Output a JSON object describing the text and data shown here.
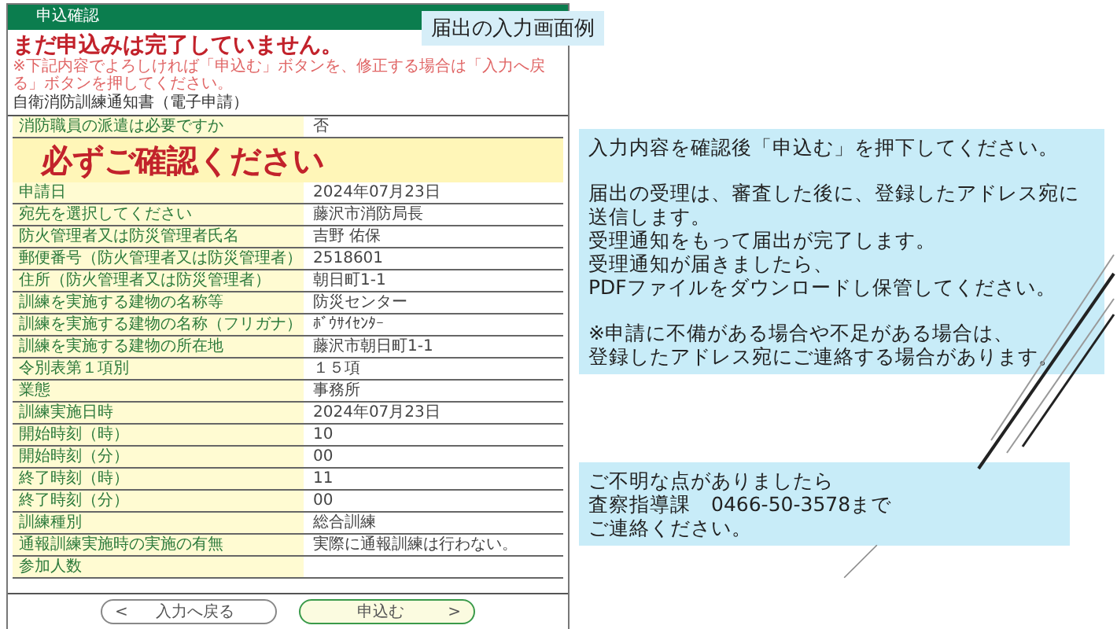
{
  "slide_label": "届出の入力画面例",
  "form": {
    "header": "申込確認",
    "title": "まだ申込みは完了していません。",
    "note": "※下記内容でよろしければ「申込む」ボタンを、修正する場合は「入力へ戻る」ボタンを押してください。",
    "doc_title": "自衛消防訓練通知書（電子申請）",
    "first_row": {
      "label": "消防職員の派遣は必要ですか",
      "value": "否"
    },
    "banner": "必ずご確認ください",
    "rows": [
      {
        "label": "申請日",
        "value": "2024年07月23日"
      },
      {
        "label": "宛先を選択してください",
        "value": "藤沢市消防局長"
      },
      {
        "label": "防火管理者又は防災管理者氏名",
        "value": "吉野 佑保"
      },
      {
        "label": "郵便番号（防火管理者又は防災管理者）",
        "value": "2518601"
      },
      {
        "label": "住所（防火管理者又は防災管理者）",
        "value": "朝日町1-1"
      },
      {
        "label": "訓練を実施する建物の名称等",
        "value": "防災センター"
      },
      {
        "label": "訓練を実施する建物の名称（フリガナ）",
        "value": "ﾎﾞｳｻｲｾﾝﾀｰ"
      },
      {
        "label": "訓練を実施する建物の所在地",
        "value": "藤沢市朝日町1-1"
      },
      {
        "label": "令別表第１項別",
        "value": "１５項"
      },
      {
        "label": "業態",
        "value": "事務所"
      },
      {
        "label": "訓練実施日時",
        "value": "2024年07月23日"
      },
      {
        "label": "開始時刻（時）",
        "value": "10"
      },
      {
        "label": "開始時刻（分）",
        "value": "00"
      },
      {
        "label": "終了時刻（時）",
        "value": "11"
      },
      {
        "label": "終了時刻（分）",
        "value": "00"
      },
      {
        "label": "訓練種別",
        "value": "総合訓練"
      },
      {
        "label": "通報訓練実施時の実施の有無",
        "value": "実際に通報訓練は行わない。"
      },
      {
        "label": "参加人数"
      }
    ],
    "buttons": [
      {
        "kind": "back",
        "arrow": "<",
        "label": "入力へ戻る"
      },
      {
        "kind": "submit",
        "label": "申込む",
        "arrow": ">"
      }
    ]
  },
  "info_boxes": [
    {
      "paragraphs": [
        [
          "入力内容を確認後「申込む」を押下してください。"
        ],
        [
          "届出の受理は、審査した後に、登録したアドレス宛に送信します。",
          "受理通知をもって届出が完了します。",
          "受理通知が届きましたら、",
          "PDFファイルをダウンロードし保管してください。"
        ],
        [
          "※申請に不備がある場合や不足がある場合は、",
          "登録したアドレス宛にご連絡する場合があります。"
        ]
      ]
    },
    {
      "paragraphs": [
        [
          "ご不明な点がありましたら",
          "査察指導課　0466-50-3578まで",
          "ご連絡ください。"
        ]
      ]
    }
  ]
}
